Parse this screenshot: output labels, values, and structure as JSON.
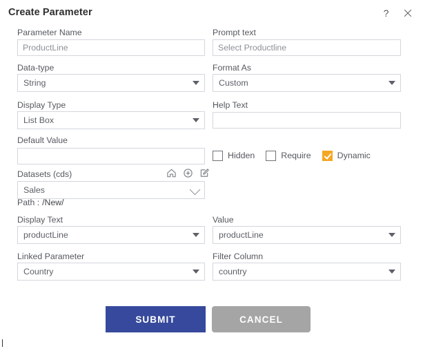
{
  "dialog": {
    "title": "Create Parameter",
    "help_icon": "question-mark-icon",
    "close_icon": "close-icon"
  },
  "form": {
    "parameter_name": {
      "label": "Parameter Name",
      "value": "ProductLine",
      "placeholder": "ProductLine"
    },
    "prompt_text": {
      "label": "Prompt text",
      "value": "Select Productline",
      "placeholder": "Select Productline"
    },
    "data_type": {
      "label": "Data-type",
      "value": "String"
    },
    "format_as": {
      "label": "Format As",
      "value": "Custom"
    },
    "display_type": {
      "label": "Display Type",
      "value": "List Box"
    },
    "help_text": {
      "label": "Help Text",
      "value": "",
      "placeholder": ""
    },
    "default_value": {
      "label": "Default Value",
      "value": "",
      "placeholder": ""
    },
    "datasets": {
      "label": "Datasets (cds)",
      "value": "Sales",
      "icons": [
        "home-icon",
        "plus-circle-icon",
        "edit-pencil-icon"
      ],
      "path_label": "Path :",
      "path_value": "/New/"
    },
    "display_text": {
      "label": "Display Text",
      "value": "productLine"
    },
    "value_field": {
      "label": "Value",
      "value": "productLine"
    },
    "linked_parameter": {
      "label": "Linked Parameter",
      "value": "Country"
    },
    "filter_column": {
      "label": "Filter Column",
      "value": "country"
    }
  },
  "options": {
    "hidden": {
      "label": "Hidden",
      "checked": false
    },
    "require": {
      "label": "Require",
      "checked": false
    },
    "dynamic": {
      "label": "Dynamic",
      "checked": true
    }
  },
  "actions": {
    "submit": "SUBMIT",
    "cancel": "CANCEL"
  },
  "colors": {
    "submit_blue": "#36499C",
    "cancel_grey": "#A5A5A5",
    "checkbox_orange": "#F5A623",
    "border_grey": "#D3D6DC",
    "label_text": "#54585E"
  }
}
